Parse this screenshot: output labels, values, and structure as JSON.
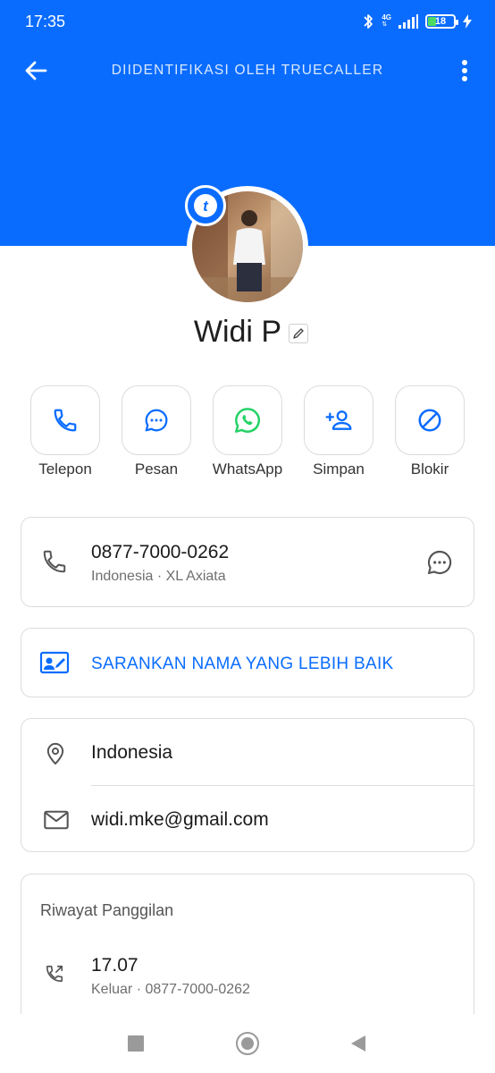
{
  "status_bar": {
    "time": "17:35",
    "network": "4G",
    "battery": "18",
    "icons": [
      "bluetooth-icon",
      "signal-icon",
      "battery-icon",
      "charging-icon"
    ]
  },
  "app_bar": {
    "title": "DIIDENTIFIKASI OLEH TRUECALLER",
    "back_icon": "arrow-left-icon",
    "menu_icon": "more-vertical-icon"
  },
  "profile": {
    "name": "Widi P",
    "badge_letter": "t"
  },
  "actions": [
    {
      "label": "Telepon",
      "icon": "phone-icon"
    },
    {
      "label": "Pesan",
      "icon": "message-icon"
    },
    {
      "label": "WhatsApp",
      "icon": "whatsapp-icon"
    },
    {
      "label": "Simpan",
      "icon": "add-person-icon"
    },
    {
      "label": "Blokir",
      "icon": "block-icon"
    }
  ],
  "phone": {
    "number": "0877-7000-0262",
    "detail": "Indonesia · XL Axiata"
  },
  "suggest": {
    "label": "SARANKAN NAMA YANG LEBIH BAIK"
  },
  "info": {
    "location": "Indonesia",
    "email": "widi.mke@gmail.com"
  },
  "history": {
    "title": "Riwayat Panggilan",
    "items": [
      {
        "time": "17.07",
        "detail": "Keluar · 0877-7000-0262"
      }
    ]
  },
  "colors": {
    "brand": "#0a6cff",
    "whatsapp": "#25d366"
  }
}
